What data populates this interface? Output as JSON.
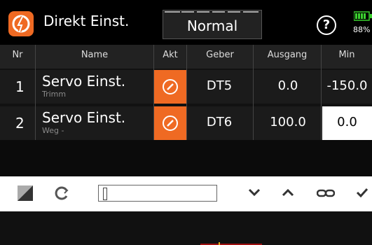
{
  "header": {
    "title": "Direkt Einst.",
    "mode": "Normal",
    "help": "?",
    "battery_pct": "88%"
  },
  "table": {
    "columns": [
      "Nr",
      "Name",
      "Akt",
      "Geber",
      "Ausgang",
      "Min"
    ],
    "rows": [
      {
        "nr": "1",
        "name": "Servo Einst.",
        "sub": "Trimm",
        "geber": "DT5",
        "ausgang": "0.0",
        "min": "-150.0"
      },
      {
        "nr": "2",
        "name": "Servo Einst.",
        "sub": "Weg -",
        "geber": "DT6",
        "ausgang": "100.0",
        "min": "0.0"
      }
    ]
  },
  "colors": {
    "accent": "#ef6a23",
    "battery": "#3bd12f"
  },
  "toolbar": {
    "icons": [
      "square-icon",
      "refresh-icon",
      "slider",
      "chevron-down-icon",
      "chevron-up-icon",
      "link-icon",
      "check-icon"
    ]
  }
}
